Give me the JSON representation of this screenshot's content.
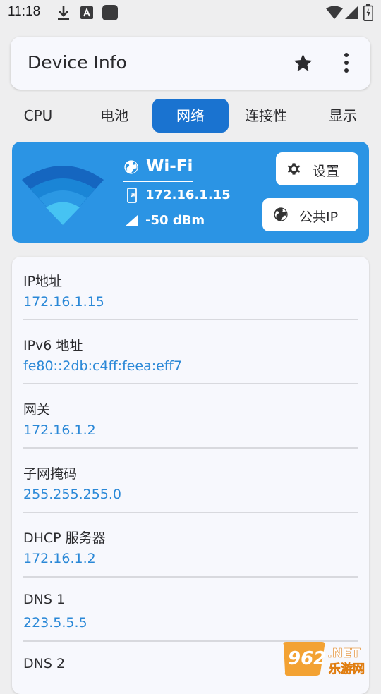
{
  "status_bar": {
    "time": "11:18",
    "icons": [
      "download-icon",
      "font-app-icon",
      "app-square-icon",
      "wifi-signal-icon",
      "cell-signal-icon",
      "battery-charging-icon"
    ]
  },
  "app_bar": {
    "title": "Device Info",
    "actions": [
      "star-icon",
      "more-vert-icon"
    ]
  },
  "tabs": [
    {
      "label": "CPU",
      "active": false
    },
    {
      "label": "电池",
      "active": false
    },
    {
      "label": "网络",
      "active": true
    },
    {
      "label": "连接性",
      "active": false
    },
    {
      "label": "显示",
      "active": false
    }
  ],
  "wifi_card": {
    "title": "Wi-Fi",
    "ip": "172.16.1.15",
    "signal": "-50 dBm",
    "settings_label": "设置",
    "public_ip_label": "公共IP",
    "colors": {
      "card": "#2b94e4",
      "wave_outer": "#1566c0",
      "wave_mid": "#1a85d6",
      "wave_inner": "#46c3f3"
    }
  },
  "details": [
    {
      "label": "IP地址",
      "value": "172.16.1.15"
    },
    {
      "label": "IPv6 地址",
      "value": "fe80::2db:c4ff:feea:eff7"
    },
    {
      "label": "网关",
      "value": "172.16.1.2"
    },
    {
      "label": "子网掩码",
      "value": "255.255.255.0"
    },
    {
      "label": "DHCP 服务器",
      "value": "172.16.1.2"
    },
    {
      "label": "DNS 1",
      "value": "223.5.5.5"
    },
    {
      "label": "DNS 2",
      "value": ""
    }
  ],
  "watermark": {
    "brand_number": "962",
    "brand_suffix": ".NET",
    "brand_cn": "乐游网"
  },
  "colors": {
    "accent": "#1a73d0",
    "value_text": "#2a88d7",
    "background": "#eeeeef",
    "card": "#f7f8fd"
  }
}
